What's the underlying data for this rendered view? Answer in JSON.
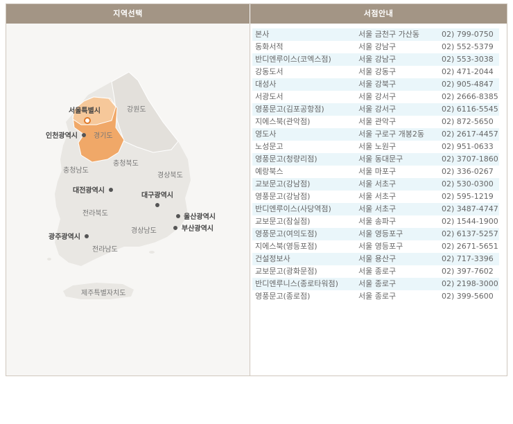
{
  "headers": {
    "region_select": "지역선택",
    "store_info": "서점안내"
  },
  "map": {
    "regions": {
      "seoul": "서울특별시",
      "gangwon": "강원도",
      "incheon": "인천광역시",
      "gyeonggi": "경기도",
      "chungbuk": "충청북도",
      "chungnam": "충청남도",
      "gyeongbuk": "경상북도",
      "daejeon": "대전광역시",
      "daegu": "대구광역시",
      "jeonbuk": "전라북도",
      "ulsan": "울산광역시",
      "busan": "부산광역시",
      "gyeongnam": "경상남도",
      "gwangju": "광주광역시",
      "jeonnam": "전라남도",
      "jeju": "제주특별자치도"
    },
    "colors": {
      "selected_region": "#f0a868",
      "selected_region_light": "#f6c89a",
      "land": "#e9e7e3",
      "sea": "#f7f6f4"
    }
  },
  "stores": [
    {
      "name": "본사",
      "location": "서울 금천구 가산동",
      "phone": "02) 799-0750"
    },
    {
      "name": "동화서적",
      "location": "서울 강남구",
      "phone": "02) 552-5379"
    },
    {
      "name": "반디엔루이스(코엑스점)",
      "location": "서울 강남구",
      "phone": "02) 553-3038"
    },
    {
      "name": "강동도서",
      "location": "서울 강동구",
      "phone": "02) 471-2044"
    },
    {
      "name": "대성사",
      "location": "서울 강북구",
      "phone": "02) 905-4847"
    },
    {
      "name": "서광도서",
      "location": "서울 강서구",
      "phone": "02) 2666-8385"
    },
    {
      "name": "영풍문고(김포공항점)",
      "location": "서울 강서구",
      "phone": "02) 6116-5545"
    },
    {
      "name": "지에스북(관악점)",
      "location": "서울 관악구",
      "phone": "02) 872-5650"
    },
    {
      "name": "영도사",
      "location": "서울 구로구 개봉2동",
      "phone": "02) 2617-4457"
    },
    {
      "name": "노성문고",
      "location": "서울 노원구",
      "phone": "02) 951-0633"
    },
    {
      "name": "영풍문고(청량리점)",
      "location": "서울 동대문구",
      "phone": "02) 3707-1860"
    },
    {
      "name": "예랑북스",
      "location": "서울 마포구",
      "phone": "02) 336-0267"
    },
    {
      "name": "교보문고(강남점)",
      "location": "서울 서초구",
      "phone": "02) 530-0300"
    },
    {
      "name": "영풍문고(강남점)",
      "location": "서울 서초구",
      "phone": "02) 595-1219"
    },
    {
      "name": "반디엔루이스(사당역점)",
      "location": "서울 서초구",
      "phone": "02) 3487-4747"
    },
    {
      "name": "교보문고(잠실점)",
      "location": "서울 송파구",
      "phone": "02) 1544-1900"
    },
    {
      "name": "영풍문고(여의도점)",
      "location": "서울 영등포구",
      "phone": "02) 6137-5257"
    },
    {
      "name": "지에스북(영등포점)",
      "location": "서울 영등포구",
      "phone": "02) 2671-5651"
    },
    {
      "name": "건설정보사",
      "location": "서울 용산구",
      "phone": "02) 717-3396"
    },
    {
      "name": "교보문고(광화문점)",
      "location": "서울 종로구",
      "phone": "02) 397-7602"
    },
    {
      "name": "반디엔루니스(종로타워점)",
      "location": "서울 종로구",
      "phone": "02) 2198-3000"
    },
    {
      "name": "영풍문고(종로점)",
      "location": "서울 종로구",
      "phone": "02) 399-5600"
    }
  ]
}
